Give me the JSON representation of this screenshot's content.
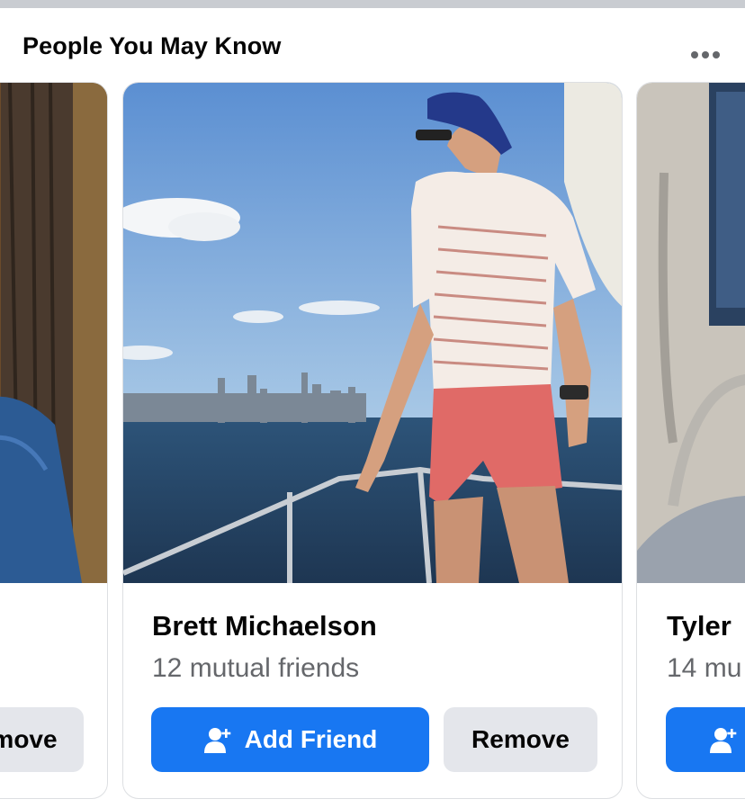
{
  "section": {
    "title": "People You May Know",
    "more_icon": "more-horizontal-icon"
  },
  "cards": [
    {
      "name": "",
      "mutual": "",
      "remove_label": "move"
    },
    {
      "name": "Brett Michaelson",
      "mutual": "12 mutual friends",
      "add_label": "Add Friend",
      "remove_label": "Remove"
    },
    {
      "name": "Tyler",
      "mutual": "14 mu"
    }
  ],
  "colors": {
    "accent": "#1877f2",
    "secondary_button": "#e4e6eb",
    "muted_text": "#65676b",
    "divider": "#c9ccd1"
  }
}
